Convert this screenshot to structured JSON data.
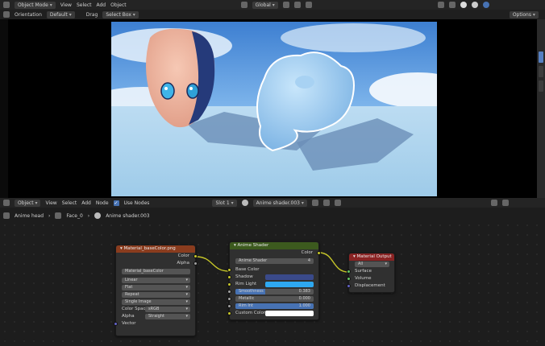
{
  "viewport_header": {
    "mode": "Object Mode",
    "menus": [
      "View",
      "Select",
      "Add",
      "Object"
    ],
    "transform_orientation": "Global",
    "right_icons": [
      "overlay-icon",
      "shading-solid-icon",
      "shading-material-icon",
      "shading-rendered-icon"
    ]
  },
  "viewport_tool_header": {
    "orientation_label": "Orientation",
    "orientation_value": "Default",
    "drag_label": "Drag",
    "drag_value": "Select Box",
    "options_label": "Options"
  },
  "node_header": {
    "object_label": "Object",
    "menus": [
      "View",
      "Select",
      "Add",
      "Node"
    ],
    "use_nodes_label": "Use Nodes",
    "use_nodes_checked": true,
    "slot_value": "Slot 1",
    "material_name": "Anime shader.003"
  },
  "breadcrumbs": [
    "Anime head",
    "Face_0",
    "Anime shader.003"
  ],
  "nodes": {
    "image_texture": {
      "title": "Material_baseColor.png",
      "header_color": "#8a3c1e",
      "outputs": [
        "Color",
        "Alpha"
      ],
      "image_name": "Material_baseColor",
      "interpolation": "Linear",
      "projection": "Flat",
      "extension": "Repeat",
      "source": "Single Image",
      "color_space_label": "Color Space",
      "color_space_value": "sRGB",
      "alpha_label": "Alpha",
      "alpha_value": "Straight",
      "vector_label": "Vector"
    },
    "anime_shader": {
      "title": "Anime Shader",
      "header_color": "#3c5a1e",
      "output": "Color",
      "group_name": "Anime Shader",
      "users": "4",
      "inputs": {
        "base_color": "Base Color",
        "shadow": "Shadow",
        "rim_light": "Rim Light",
        "smoothness": "Smoothness",
        "smoothness_value": "0.383",
        "metallic": "Metallic",
        "metallic_value": "0.000",
        "rim_int": "Rim Int",
        "rim_int_value": "1.000",
        "custom_color": "Custom Color"
      },
      "shadow_color": "#3a4a8a",
      "rim_light_color": "#2ea8f0",
      "custom_color_value": "#ffffff",
      "smoothness_fill": 0.383,
      "rim_int_fill": 1.0
    },
    "material_output": {
      "title": "Material Output",
      "header_color": "#8a2323",
      "target": "All",
      "inputs": [
        "Surface",
        "Volume",
        "Displacement"
      ]
    }
  }
}
